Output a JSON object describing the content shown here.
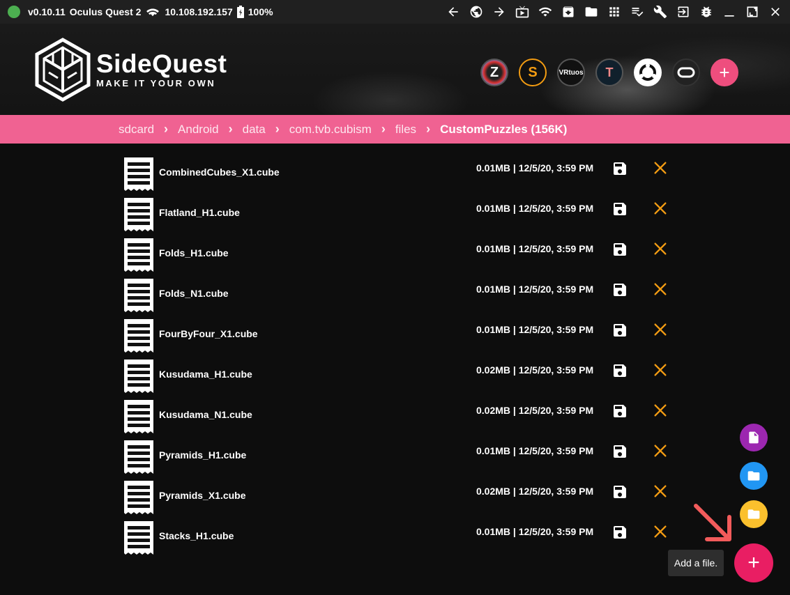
{
  "status_bar": {
    "version": "v0.10.11",
    "device": "Oculus Quest 2",
    "ip": "10.108.192.157",
    "battery": "100%",
    "icons": [
      "back-arrow-icon",
      "globe-icon",
      "forward-arrow-icon",
      "screen-cast-icon",
      "wifi-icon",
      "download-box-icon",
      "folder-icon",
      "grid-icon",
      "tasks-icon",
      "wrench-icon",
      "login-icon",
      "bug-icon",
      "minimize-icon",
      "maximize-icon",
      "close-icon"
    ]
  },
  "header": {
    "logo_title": "SideQuest",
    "logo_subtitle": "MAKE IT YOUR OWN",
    "app_icons": [
      {
        "name": "Z",
        "text": "Z"
      },
      {
        "name": "S",
        "text": "S"
      },
      {
        "name": "VRtuos",
        "text": "VRtuos"
      },
      {
        "name": "T",
        "text": "T"
      },
      {
        "name": "ring",
        "text": ""
      },
      {
        "name": "oculus",
        "text": ""
      }
    ],
    "add_label": "+"
  },
  "breadcrumb": {
    "items": [
      "sdcard",
      "Android",
      "data",
      "com.tvb.cubism",
      "files"
    ],
    "current": "CustomPuzzles (156K)"
  },
  "files": [
    {
      "name": "CombinedCubes_X1.cube",
      "meta": "0.01MB | 12/5/20, 3:59 PM"
    },
    {
      "name": "Flatland_H1.cube",
      "meta": "0.01MB | 12/5/20, 3:59 PM"
    },
    {
      "name": "Folds_H1.cube",
      "meta": "0.01MB | 12/5/20, 3:59 PM"
    },
    {
      "name": "Folds_N1.cube",
      "meta": "0.01MB | 12/5/20, 3:59 PM"
    },
    {
      "name": "FourByFour_X1.cube",
      "meta": "0.01MB | 12/5/20, 3:59 PM"
    },
    {
      "name": "Kusudama_H1.cube",
      "meta": "0.02MB | 12/5/20, 3:59 PM"
    },
    {
      "name": "Kusudama_N1.cube",
      "meta": "0.02MB | 12/5/20, 3:59 PM"
    },
    {
      "name": "Pyramids_H1.cube",
      "meta": "0.01MB | 12/5/20, 3:59 PM"
    },
    {
      "name": "Pyramids_X1.cube",
      "meta": "0.02MB | 12/5/20, 3:59 PM"
    },
    {
      "name": "Stacks_H1.cube",
      "meta": "0.01MB | 12/5/20, 3:59 PM"
    }
  ],
  "fab": {
    "main_label": "+",
    "tooltip": "Add a file."
  },
  "colors": {
    "accent_pink": "#f06292",
    "fab_red": "#e91e63",
    "delete_orange": "#f39c12",
    "fab_purple": "#9c27b0",
    "fab_blue": "#2196f3",
    "fab_yellow": "#fbc02d"
  }
}
